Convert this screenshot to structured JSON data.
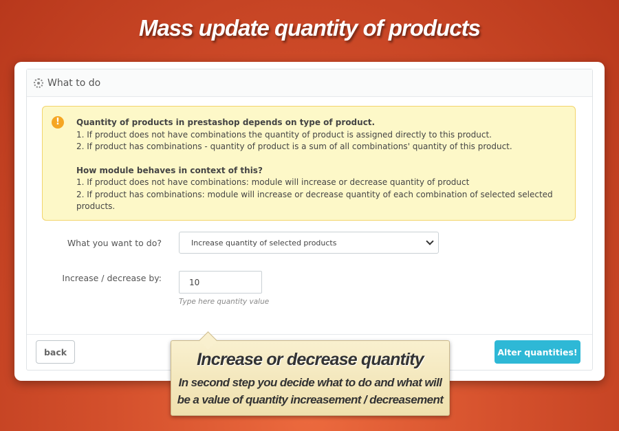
{
  "banner": {
    "title": "Mass update quantity of products"
  },
  "panel": {
    "title": "What to do",
    "icon": "gear-icon"
  },
  "alert": {
    "icon": "exclamation-icon",
    "heading1": "Quantity of products in prestashop depends on type of product.",
    "line1": "1. If product does not have combinations the quantity of product is assigned directly to this product.",
    "line2": "2. If product has combinations - quantity of product is a sum of all combinations' quantity of this product.",
    "heading2": "How module behaves in context of this?",
    "line3": "1. If product does not have combinations: module will increase or decrease quantity of product",
    "line4": "2. If product has combinations: module will increase or decrease quantity of each combination of selected selected products."
  },
  "form": {
    "action_label": "What you want to do?",
    "action_value": "Increase quantity of selected products",
    "amount_label": "Increase / decrease by:",
    "amount_value": "10",
    "amount_hint": "Type here quantity value"
  },
  "buttons": {
    "back": "back",
    "alter": "Alter quantities!"
  },
  "callout": {
    "title": "Increase or decrease quantity",
    "text": "In second step you decide what to do and what will be a value of quantity increasement / decreasement"
  },
  "colors": {
    "accent": "#2eb8d6",
    "alert_bg": "#fdf8c8",
    "alert_border": "#f2d46b",
    "background": "#d4502c"
  }
}
